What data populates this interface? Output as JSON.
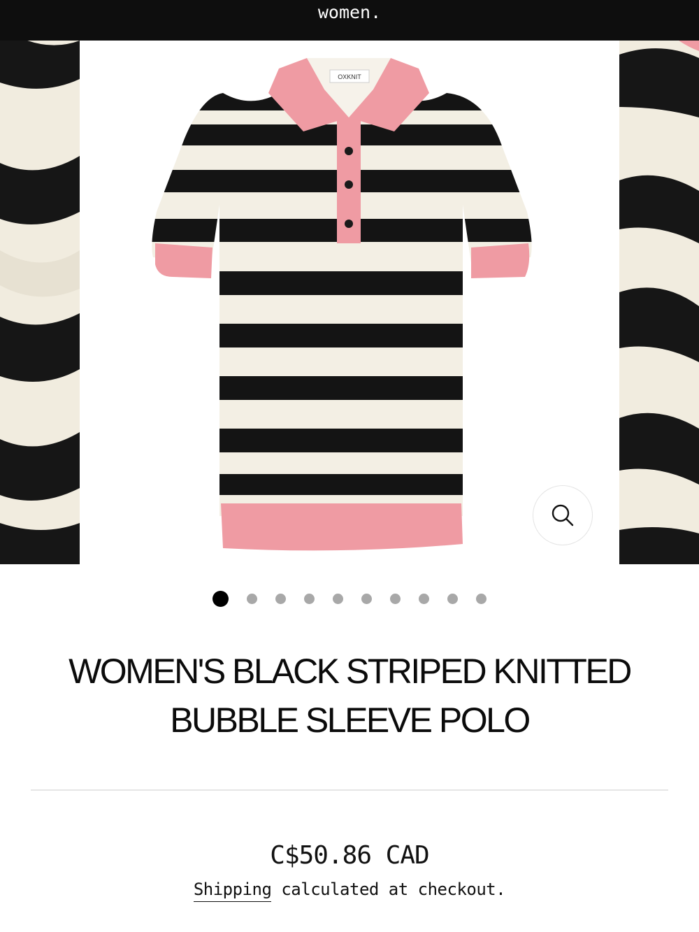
{
  "header": {
    "brand": "women."
  },
  "product": {
    "title": "WOMEN'S BLACK STRIPED KNITTED BUBBLE SLEEVE POLO",
    "price": "C$50.86 CAD",
    "shipping_link": "Shipping",
    "shipping_rest": " calculated at checkout.",
    "label_text": "OXKNIT"
  },
  "gallery": {
    "image_count": 10,
    "active_index": 0,
    "zoom_icon": "magnifier-icon"
  },
  "colors": {
    "stripe_black": "#141414",
    "stripe_cream": "#f3efe4",
    "trim_pink": "#ef9ba3",
    "header_bg": "#0e0e0e"
  }
}
